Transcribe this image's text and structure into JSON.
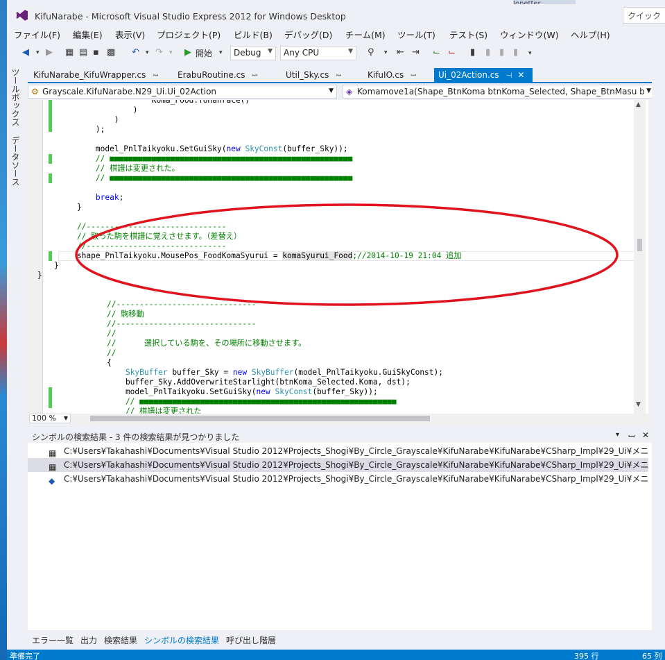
{
  "window": {
    "title": "KifuNarabe - Microsoft Visual Studio Express 2012 for Windows Desktop",
    "quick_launch": "クイック",
    "ext_tab": "Jonetter"
  },
  "menu": [
    "ファイル(F)",
    "編集(E)",
    "表示(V)",
    "プロジェクト(P)",
    "ビルド(B)",
    "デバッグ(D)",
    "チーム(M)",
    "ツール(T)",
    "テスト(S)",
    "ウィンドウ(W)",
    "ヘルプ(H)"
  ],
  "toolbar": {
    "start_label": "開始",
    "config": "Debug",
    "platform": "Any CPU"
  },
  "left_strip": [
    "ツールボックス",
    "データソース"
  ],
  "tabs": [
    {
      "label": "KifuNarabe_KifuWrapper.cs",
      "pin": "ꟷ"
    },
    {
      "label": "ErabuRoutine.cs",
      "pin": "ꟷ"
    },
    {
      "label": "Util_Sky.cs",
      "pin": "ꟷ"
    },
    {
      "label": "KifuIO.cs",
      "pin": "ꟷ"
    },
    {
      "label": "Ui_02Action.cs",
      "pin": "⊣",
      "close": "✕"
    }
  ],
  "nav": {
    "class": "Grayscale.KifuNarabe.N29_Ui.Ui_02Action",
    "member": "Komamove1a(Shape_BtnKoma btnKoma_Selected, Shape_BtnMasu b"
  },
  "code": {
    "l0": "                    Koma_Food.ToHanrace()",
    "l1": "                )",
    "l2": "            )",
    "l3": "        );",
    "l4a": "        model_PnlTaikyoku.SetGuiSky(",
    "l4k": "new",
    "l4t": "SkyConst",
    "l4b": "(buffer_Sky));",
    "l5": "        // ■■■■■■■■■■■■■■■■■■■■■■■■■■■■■■■■■■■■■■■■■■■■■■■■■■■■",
    "l6": "        // 棋譜は変更された。",
    "l7": "        // ■■■■■■■■■■■■■■■■■■■■■■■■■■■■■■■■■■■■■■■■■■■■■■■■■■■■",
    "l8": "break",
    "l9": "    }",
    "l10": "    //------------------------------",
    "l11": "    // 取った駒を棋譜に覚えさせます。（差替え）",
    "l12": "    //------------------------------",
    "l13a": "    shape_PnlTaikyoku.MousePos_FoodKomaSyurui = ",
    "l13h": "komaSyurui_Food",
    "l13c": ";//2014-10-19 21:04 追加",
    "l14": "}",
    "l15": "}",
    "l16": "//------------------------------",
    "l17": "// 駒移動",
    "l18": "//------------------------------",
    "l19": "//",
    "l20": "//      選択している駒を、その場所に移動させます。",
    "l21": "//",
    "l22": "{",
    "l23t": "SkyBuffer",
    "l23a": " buffer_Sky = ",
    "l23k": "new",
    "l23b": "(model_PnlTaikyoku.GuiSkyConst);",
    "l24": "    buffer_Sky.AddOverwriteStarlight(btnKoma_Selected.Koma, dst);",
    "l25a": "    model_PnlTaikyoku.SetGuiSky(",
    "l25k": "new",
    "l25t": "SkyConst",
    "l25b": "(buffer_Sky));",
    "l26": "    // ■■■■■■■■■■■■■■■■■■■■■■■■■■■■■■■■■■■■■■■■■■■■■■■■■■■■■■■",
    "l27": "    // 棋譜は変更された"
  },
  "zoom": "100 %",
  "results": {
    "title": "シンボルの検索結果 - 3 件の検索結果が見つかりました",
    "rows": [
      "C:¥Users¥Takahashi¥Documents¥Visual Studio 2012¥Projects_Shogi¥By_Circle_Grayscale¥KifuNarabe¥KifuNarabe¥CSharp_Impl¥29_Ui¥メニュー¥",
      "C:¥Users¥Takahashi¥Documents¥Visual Studio 2012¥Projects_Shogi¥By_Circle_Grayscale¥KifuNarabe¥KifuNarabe¥CSharp_Impl¥29_Ui¥メニュー¥",
      "C:¥Users¥Takahashi¥Documents¥Visual Studio 2012¥Projects_Shogi¥By_Circle_Grayscale¥KifuNarabe¥KifuNarabe¥CSharp_Impl¥29_Ui¥メニュー¥"
    ]
  },
  "bottom_tabs": [
    "エラー一覧",
    "出力",
    "検索結果",
    "シンボルの検索結果",
    "呼び出し階層"
  ],
  "status": {
    "left": "準備完了",
    "line": "395 行",
    "col": "65 列"
  },
  "colors": {
    "accent": "#007acc",
    "annotation": "#e0141e",
    "change_bar": "#57c957"
  }
}
